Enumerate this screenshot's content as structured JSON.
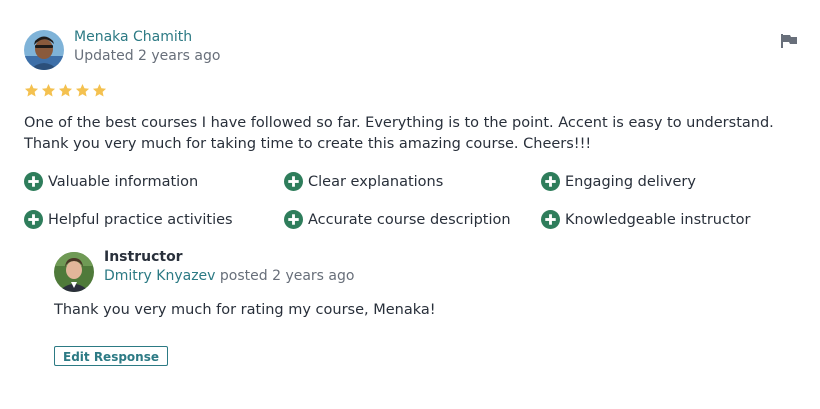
{
  "reviewer": {
    "name": "Menaka Chamith",
    "updated": "Updated 2 years ago",
    "avatar_icon": "user-avatar-photo"
  },
  "rating": {
    "value": 5,
    "max": 5,
    "color": "#f4c150"
  },
  "review": {
    "text": "One of the best courses I have followed so far. Everything is to the point. Accent is easy to understand. Thank you very much for taking time to create this amazing course. Cheers!!!"
  },
  "tags": [
    "Valuable information",
    "Clear explanations",
    "Engaging delivery",
    "Helpful practice activities",
    "Accurate course description",
    "Knowledgeable instructor"
  ],
  "response": {
    "role": "Instructor",
    "name": "Dmitry Knyazev",
    "posted": " posted 2 years ago",
    "text": "Thank you very much for rating my course, Menaka!",
    "edit_label": "Edit Response"
  },
  "colors": {
    "accent": "#2c7a84",
    "tag_icon": "#2e7d5b",
    "muted": "#686f7a",
    "text": "#29303b"
  },
  "icons": {
    "flag": "flag-icon",
    "tag": "plus-circle-icon",
    "star": "star-icon"
  }
}
